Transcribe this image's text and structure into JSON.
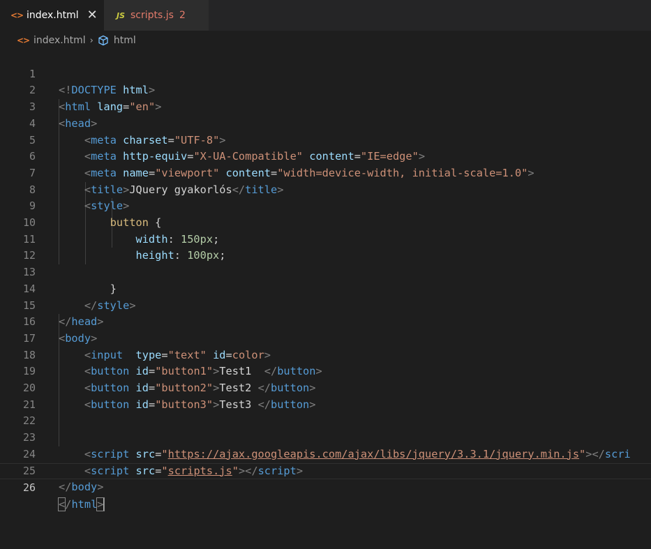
{
  "tabs": [
    {
      "label": "index.html",
      "icon": "html-icon",
      "active": true,
      "close_glyph": "✕"
    },
    {
      "label": "scripts.js",
      "icon": "js-icon",
      "badge": "2",
      "active": false
    }
  ],
  "breadcrumb": {
    "file": "index.html",
    "symbol": "html"
  },
  "line_numbers": [
    "1",
    "2",
    "3",
    "4",
    "5",
    "6",
    "7",
    "8",
    "9",
    "10",
    "11",
    "12",
    "13",
    "14",
    "15",
    "16",
    "17",
    "18",
    "19",
    "20",
    "21",
    "22",
    "23",
    "24",
    "25",
    "26"
  ],
  "code": {
    "l1": {
      "open": "<!",
      "doctype": "DOCTYPE",
      "name": "html",
      "close": ">"
    },
    "l2": {
      "tag": "html",
      "attr": "lang",
      "value": "\"en\""
    },
    "l3": {
      "tag": "head"
    },
    "l4": {
      "tag": "meta",
      "attr": "charset",
      "value": "\"UTF-8\""
    },
    "l5": {
      "tag": "meta",
      "attr1": "http-equiv",
      "value1": "\"X-UA-Compatible\"",
      "attr2": "content",
      "value2": "\"IE=edge\""
    },
    "l6": {
      "tag": "meta",
      "attr1": "name",
      "value1": "\"viewport\"",
      "attr2": "content",
      "value2": "\"width=device-width, initial-scale=1.0\""
    },
    "l7": {
      "tag": "title",
      "text": "JQuery gyakorlós"
    },
    "l8": {
      "tag": "style"
    },
    "l9": {
      "selector": "button",
      "brace": "{"
    },
    "l10": {
      "prop": "width",
      "value": "150px"
    },
    "l11": {
      "prop": "height",
      "value": "100px"
    },
    "l13": {
      "brace": "}"
    },
    "l14": {
      "tag": "style"
    },
    "l15": {
      "tag": "head"
    },
    "l16": {
      "tag": "body"
    },
    "l17": {
      "tag": "input",
      "attr1": "type",
      "value1": "\"text\"",
      "attr2": "id",
      "value2": "color"
    },
    "l18": {
      "tag": "button",
      "attr": "id",
      "value": "\"button1\"",
      "text": "Test1  "
    },
    "l19": {
      "tag": "button",
      "attr": "id",
      "value": "\"button2\"",
      "text": "Test2 "
    },
    "l20": {
      "tag": "button",
      "attr": "id",
      "value": "\"button3\"",
      "text": "Test3 "
    },
    "l23": {
      "tag": "script",
      "attr": "src",
      "url": "https://ajax.googleapis.com/ajax/libs/jquery/3.3.1/jquery.min.js",
      "close_tag": "scri"
    },
    "l24": {
      "tag": "script",
      "attr": "src",
      "url": "scripts.js"
    },
    "l25": {
      "tag": "body"
    },
    "l26": {
      "tag": "html"
    }
  },
  "colors": {
    "background": "#1e1e1e",
    "tag": "#569cd6",
    "attribute": "#9cdcfe",
    "string": "#ce9178",
    "number": "#b5cea8",
    "selector": "#d7ba7d",
    "html_icon": "#e37933",
    "js_icon": "#cbcb41",
    "error_tab": "#e37b6b"
  }
}
